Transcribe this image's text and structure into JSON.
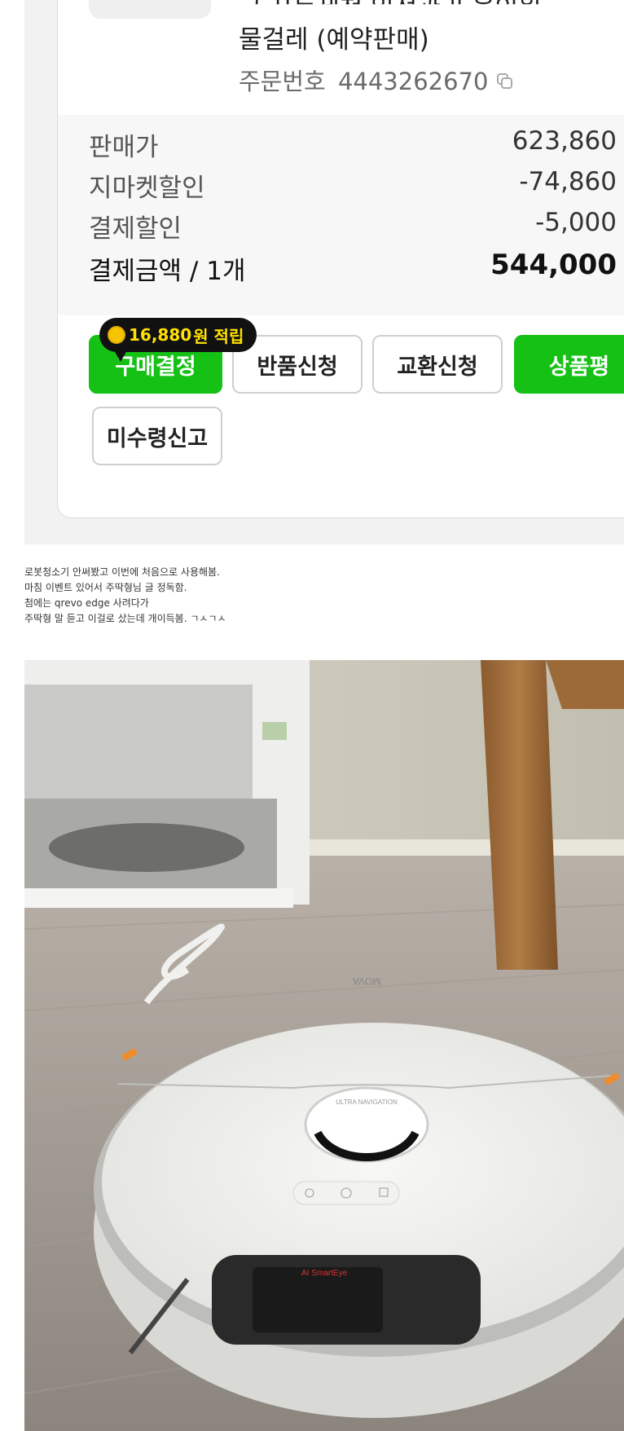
{
  "order": {
    "product_name_line1": "구 자동세척 일정관리 올인원",
    "product_name_line2": "물걸레 (예약판매)",
    "order_number_label": "주문번호",
    "order_number": "4443262670"
  },
  "prices": [
    {
      "label": "판매가",
      "value": "623,860"
    },
    {
      "label": "지마켓할인",
      "value": "-74,860"
    },
    {
      "label": "결제할인",
      "value": "-5,000"
    },
    {
      "label": "결제금액 / 1개",
      "value": "544,000"
    }
  ],
  "points_badge": {
    "amount": "16,880",
    "suffix": "원 적립"
  },
  "buttons": {
    "purchase_confirm": "구매결정",
    "return_request": "반품신청",
    "exchange_request": "교환신청",
    "review": "상품평",
    "not_received": "미수령신고"
  },
  "post_lines": [
    "로봇청소기 안써봤고 이번에 처음으로 사용해봄.",
    "마침 이벤트 있어서 주딱형님 글 정독함.",
    "첨에는 qrevo edge 사려다가",
    "주딱형 말 듣고 이걸로 샀는데 개이득봄. ㄱㅅㄱㅅ"
  ],
  "photo": {
    "robot_brand_text": "MOVA",
    "lidar_text": "ULTRA NAVIGATION",
    "front_label": "AI SmartEye"
  },
  "colors": {
    "green": "#14c114",
    "badge_bg": "#111111",
    "badge_text": "#ffe100"
  }
}
